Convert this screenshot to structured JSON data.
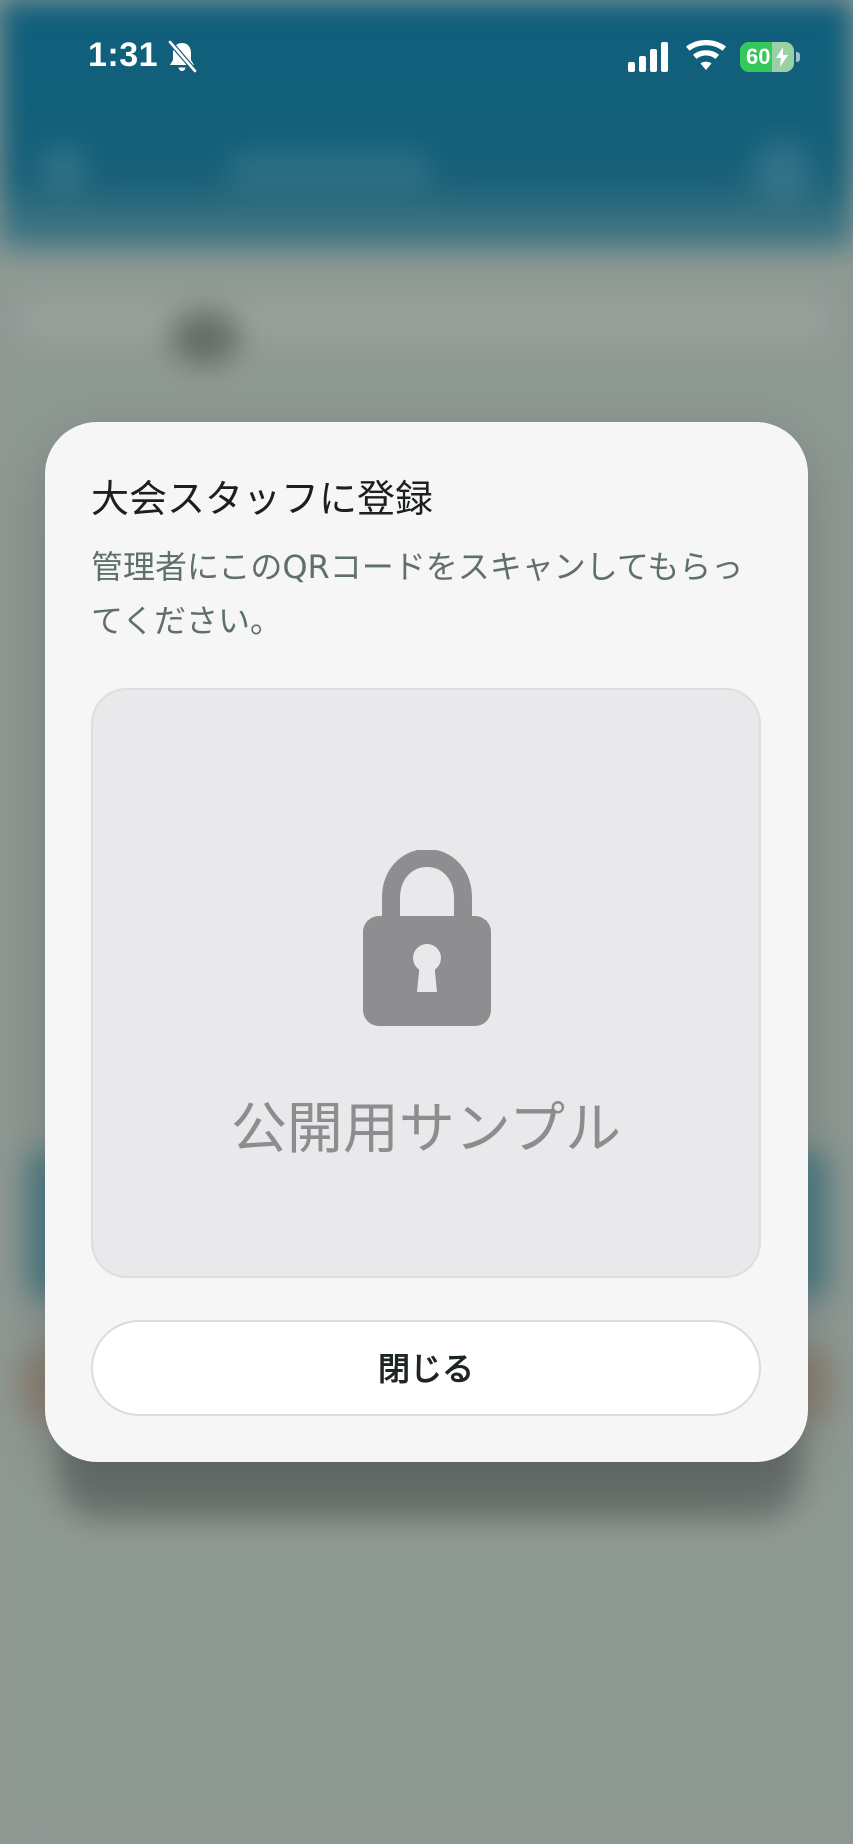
{
  "status_bar": {
    "time": "1:31",
    "battery_percent": "60",
    "battery_level": 0.6,
    "battery_color": "#34c759",
    "icons": [
      "bell-slash-icon",
      "cellular-signal-icon",
      "wifi-icon",
      "battery-charging-icon"
    ]
  },
  "dialog": {
    "title": "大会スタッフに登録",
    "message": "管理者にこのQRコードをスキャンしてもらってください。",
    "qr_placeholder": {
      "icon": "lock-icon",
      "label": "公開用サンプル"
    },
    "close_label": "閉じる"
  },
  "colors": {
    "header_teal": "#0e5f7d",
    "dialog_background": "#f6f6f7",
    "lock_gray": "#8e8e90"
  }
}
